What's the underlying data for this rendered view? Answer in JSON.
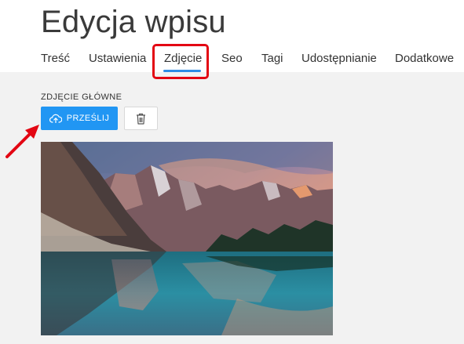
{
  "header": {
    "title": "Edycja wpisu"
  },
  "tabs": [
    {
      "label": "Treść"
    },
    {
      "label": "Ustawienia"
    },
    {
      "label": "Zdjęcie"
    },
    {
      "label": "Seo"
    },
    {
      "label": "Tagi"
    },
    {
      "label": "Udostępnianie"
    },
    {
      "label": "Dodatkowe"
    }
  ],
  "active_tab": "Zdjęcie",
  "main_image": {
    "section_label": "ZDJĘCIE GŁÓWNE",
    "upload_label": "PRZEŚLIJ",
    "upload_icon": "cloud-upload-icon",
    "delete_icon": "trash-icon"
  },
  "colors": {
    "accent": "#2196f3",
    "tab_underline": "#2d8ce6",
    "highlight": "#e30613",
    "content_bg": "#f2f2f2"
  }
}
